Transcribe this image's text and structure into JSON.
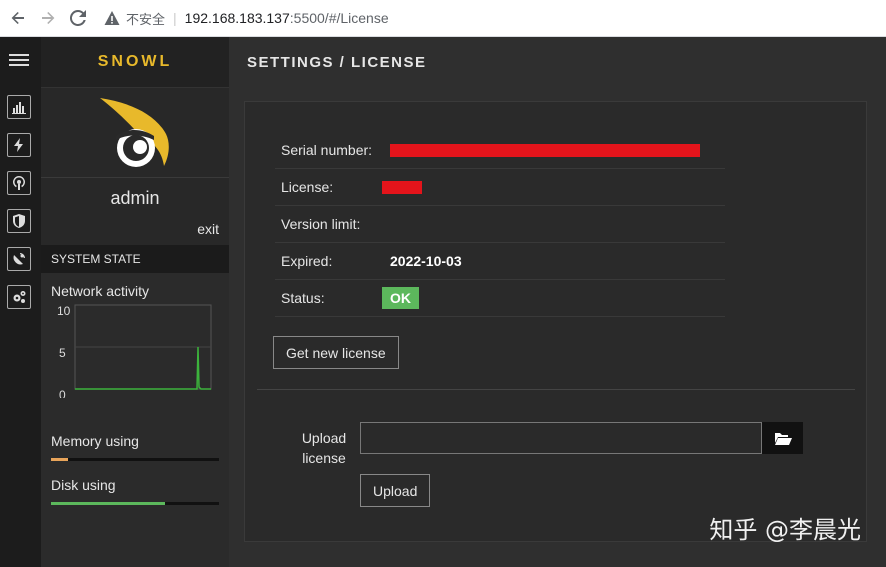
{
  "browser": {
    "insecure_label": "不安全",
    "url_host": "192.168.183.137",
    "url_path": ":5500/#/License"
  },
  "sidebar": {
    "brand": "SNOWL",
    "user_name": "admin",
    "exit_label": "exit",
    "system_state_label": "SYSTEM STATE",
    "network_label": "Network activity",
    "graph_ticks": [
      "10",
      "5",
      "0"
    ],
    "memory_label": "Memory using",
    "memory_fraction": 0.1,
    "disk_label": "Disk using",
    "disk_fraction": 0.68
  },
  "header": {
    "title": "SETTINGS / LICENSE"
  },
  "license": {
    "serial_label": "Serial number:",
    "license_label": "License:",
    "version_limit_label": "Version limit:",
    "expired_label": "Expired:",
    "expired_value": "2022-10-03",
    "status_label": "Status:",
    "status_value": "OK",
    "get_new_button": "Get new license"
  },
  "upload": {
    "label_line1": "Upload",
    "label_line2": "license",
    "input_value": "",
    "upload_button": "Upload"
  },
  "watermark": "知乎 @李晨光",
  "colors": {
    "accent": "#e8b92b",
    "ok": "#5cb85c",
    "memory_bar": "#e8a45a",
    "disk_bar": "#5cb85c",
    "graph_line": "#3cb33c"
  }
}
